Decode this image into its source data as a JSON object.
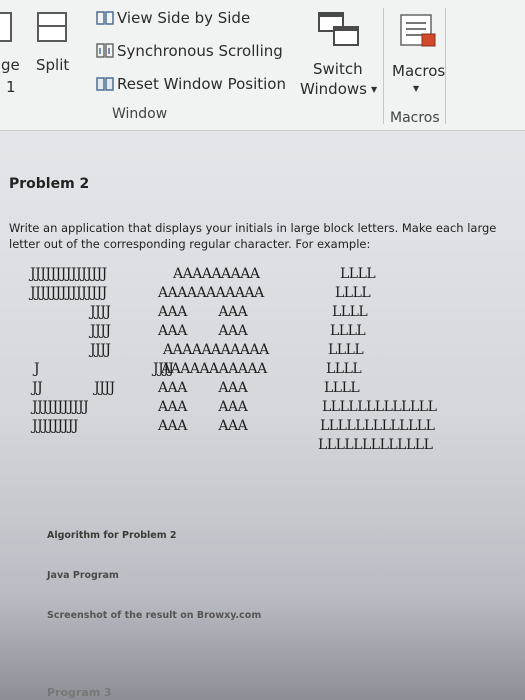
{
  "ribbon": {
    "left_labels": {
      "ge": "ge",
      "split": "Split",
      "one": "1"
    },
    "view_side_by_side": "View Side by Side",
    "synchronous_scrolling": "Synchronous Scrolling",
    "reset_window_position": "Reset Window Position",
    "window_group": "Window",
    "switch_windows_line1": "Switch",
    "switch_windows_line2": "Windows",
    "macros": "Macros",
    "macros_group": "Macros"
  },
  "document": {
    "title": "Problem 2",
    "description": "Write an application that displays your initials in large block letters. Make each large letter out of the corresponding regular character. For example:",
    "block_letters": {
      "J": [
        "JJJJJJJJJJJJJJJ",
        "JJJJJJJJJJJJJJJ",
        "JJJJ",
        "JJJJ",
        "JJJJ",
        "J   JJJJ",
        "JJ  JJJJ",
        "JJJJJJJJJJJ",
        "JJJJJJJJJ"
      ],
      "A": [
        "AAAAAAAAA",
        "AAAAAAAAAAA",
        "AAA        AAA",
        "AAA        AAA",
        "AAAAAAAAAAA",
        "AAAAAAAAAAA",
        "AAA        AAA",
        "AAA        AAA",
        "AAA        AAA"
      ],
      "L": [
        "LLLL",
        "LLLL",
        "LLLL",
        "LLLL",
        "LLLL",
        "LLLL",
        "LLLL",
        "LLLLLLLLLLLLL",
        "LLLLLLLLLLLLL",
        "LLLLLLLLLLLLL"
      ]
    },
    "algorithm_label": "Algorithm for Problem 2",
    "java_label": "Java Program",
    "screenshot_label": "Screenshot of the result on Browxy.com",
    "program3_label": "Program 3"
  }
}
